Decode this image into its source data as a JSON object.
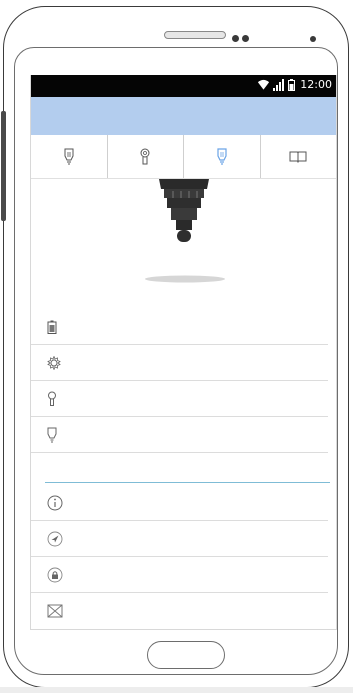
{
  "status_bar": {
    "time": "12:00",
    "icons": [
      "wifi-icon",
      "signal-icon",
      "battery-icon"
    ]
  },
  "tabs": [
    {
      "icon": "bulb-icon",
      "active": false
    },
    {
      "icon": "key-icon",
      "active": false
    },
    {
      "icon": "bulb-icon",
      "active": true
    },
    {
      "icon": "book-icon",
      "active": false
    }
  ],
  "device_list": [
    {
      "icon": "battery-icon"
    },
    {
      "icon": "gear-icon"
    },
    {
      "icon": "key-icon"
    },
    {
      "icon": "bulb-icon"
    }
  ],
  "settings_list": [
    {
      "icon": "info-icon"
    },
    {
      "icon": "navigation-icon"
    },
    {
      "icon": "lock-icon"
    },
    {
      "icon": "mail-icon"
    }
  ],
  "colors": {
    "app_bar": "#b3cdee",
    "active_tab_icon": "#6aa3e6",
    "section_divider": "#7fbcd6"
  }
}
